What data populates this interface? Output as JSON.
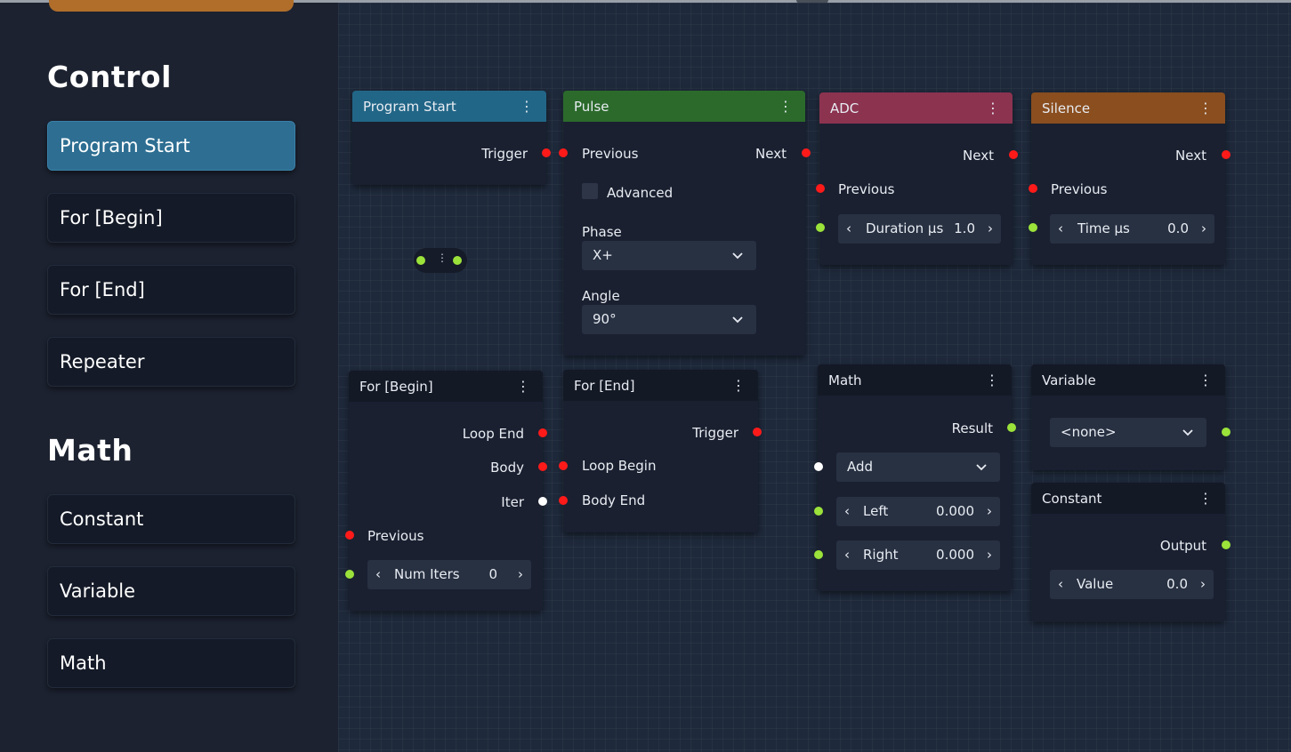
{
  "sidebar": {
    "sections": [
      {
        "title": "Control",
        "items": [
          "Program Start",
          "For [Begin]",
          "For [End]",
          "Repeater"
        ]
      },
      {
        "title": "Math",
        "items": [
          "Constant",
          "Variable",
          "Math"
        ]
      }
    ]
  },
  "nodes": {
    "program_start": {
      "title": "Program Start",
      "trigger": "Trigger",
      "header_color": "#226687"
    },
    "pulse": {
      "title": "Pulse",
      "previous": "Previous",
      "next": "Next",
      "advanced": "Advanced",
      "phase_label": "Phase",
      "phase_value": "X+",
      "angle_label": "Angle",
      "angle_value": "90°",
      "header_color": "#2b6a2b"
    },
    "adc": {
      "title": "ADC",
      "next": "Next",
      "previous": "Previous",
      "param_label": "Duration µs",
      "param_value": "1.0",
      "header_color": "#8c3350"
    },
    "silence": {
      "title": "Silence",
      "next": "Next",
      "previous": "Previous",
      "param_label": "Time µs",
      "param_value": "0.0",
      "header_color": "#8a4e1f"
    },
    "for_begin": {
      "title": "For [Begin]",
      "loop_end": "Loop End",
      "body": "Body",
      "iter": "Iter",
      "previous": "Previous",
      "param_label": "Num Iters",
      "param_value": "0"
    },
    "for_end": {
      "title": "For [End]",
      "trigger": "Trigger",
      "loop_begin": "Loop Begin",
      "body_end": "Body End"
    },
    "math": {
      "title": "Math",
      "result": "Result",
      "op_value": "Add",
      "left_label": "Left",
      "left_value": "0.000",
      "right_label": "Right",
      "right_value": "0.000"
    },
    "variable": {
      "title": "Variable",
      "select_value": "<none>"
    },
    "constant": {
      "title": "Constant",
      "output": "Output",
      "param_label": "Value",
      "param_value": "0.0"
    }
  },
  "icons": {
    "menu": "kebab-icon",
    "decrement": "chevron-left-icon",
    "increment": "chevron-right-icon",
    "dropdown": "chevron-down-icon"
  },
  "colors": {
    "port_exec": "#ff1a1a",
    "port_value": "#9be23a",
    "port_iter": "#ffffff",
    "active_palette": "#2d6e92"
  }
}
